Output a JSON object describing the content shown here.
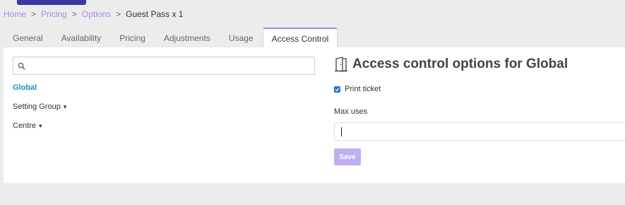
{
  "breadcrumb": {
    "items": [
      "Home",
      "Pricing",
      "Options"
    ],
    "separator": ">",
    "current": "Guest Pass x 1"
  },
  "tabs": [
    {
      "label": "General"
    },
    {
      "label": "Availability"
    },
    {
      "label": "Pricing"
    },
    {
      "label": "Adjustments"
    },
    {
      "label": "Usage"
    },
    {
      "label": "Access Control",
      "active": true
    }
  ],
  "left": {
    "search": {
      "placeholder": "",
      "value": ""
    },
    "tree": [
      {
        "label": "Global",
        "active": true,
        "expandable": false
      },
      {
        "label": "Setting Group",
        "expandable": true
      },
      {
        "label": "Centre",
        "expandable": true
      }
    ]
  },
  "right": {
    "icon": "door-icon",
    "title": "Access control options for Global",
    "print_ticket": {
      "label": "Print ticket",
      "checked": true
    },
    "max_uses": {
      "label": "Max uses",
      "value": ""
    },
    "save_label": "Save"
  },
  "colors": {
    "accent": "#a78ae6",
    "link_active": "#1a8ec6",
    "top_button": "#3c37a0",
    "save_disabled": "#c0aef0",
    "checkbox": "#2373c7"
  }
}
